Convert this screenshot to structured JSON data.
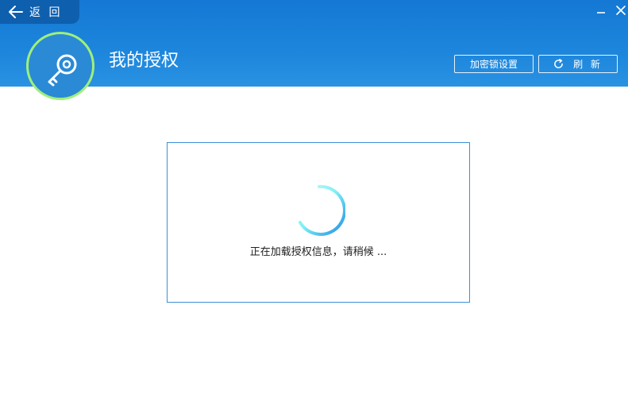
{
  "header": {
    "back_label": "返 回",
    "title": "我的授权",
    "lock_button_label": "加密锁设置",
    "refresh_button_label": "刷 新",
    "icons": {
      "back": "arrow-left-icon",
      "minimize": "minimize-icon",
      "close": "close-icon",
      "avatar": "key-icon",
      "refresh": "refresh-icon"
    }
  },
  "content": {
    "loading_text": "正在加载授权信息，请稍候 ..."
  },
  "colors": {
    "header_blue": "#1d86dc",
    "back_bg": "#0e5fae",
    "avatar_ring": "#9ef07a",
    "box_border": "#3d8fd6",
    "spinner_start": "#7ef0f5",
    "spinner_end": "#1f8fe6"
  }
}
